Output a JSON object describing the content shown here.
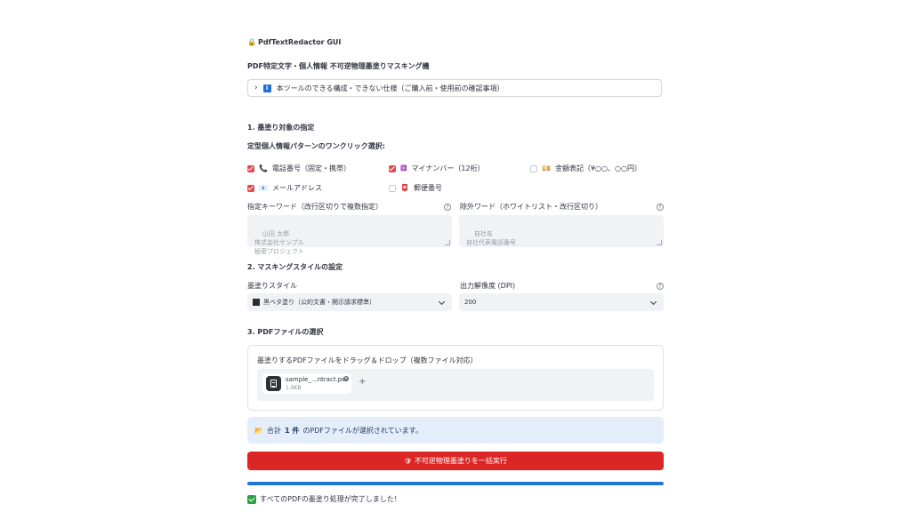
{
  "app": {
    "title": "PdfTextRedactor GUI",
    "subtitle": "PDF特定文字・個人情報 不可逆物理墨塗りマスキング機"
  },
  "expander": {
    "label": "本ツールのできる構成・できない仕様（ご購入前・使用前の確認事項）",
    "icon": "info-icon"
  },
  "section1": {
    "heading": "1. 墨塗り対象の指定",
    "patterns_label": "定型個人情報パターンのワンクリック選択:",
    "patterns": [
      {
        "label": "電話番号（固定・携帯）",
        "checked": true,
        "icon": "📞"
      },
      {
        "label": "マイナンバー（12桁）",
        "checked": true,
        "icon": "🆔"
      },
      {
        "label": "金額表記（¥○○、○○円）",
        "checked": false,
        "icon": "💴"
      },
      {
        "label": "メールアドレス",
        "checked": true,
        "icon": "📧"
      },
      {
        "label": "郵便番号",
        "checked": false,
        "icon": "📮"
      }
    ],
    "keyword_label": "指定キーワード（改行区切りで複数指定）",
    "keyword_placeholder": "山田 太郎\n株式会社サンプル\n秘密プロジェクト",
    "exclude_label": "除外ワード（ホワイトリスト・改行区切り）",
    "exclude_placeholder": "自社名\n自社代表電話番号"
  },
  "section2": {
    "heading": "2. マスキングスタイルの設定",
    "style_label": "墨塗りスタイル",
    "style_value": "黒ベタ塗り（公的文書・開示請求標準）",
    "dpi_label": "出力解像度 (DPI)",
    "dpi_value": "200"
  },
  "section3": {
    "heading": "3. PDFファイルの選択",
    "drop_label": "墨塗りするPDFファイルをドラッグ＆ドロップ（複数ファイル対応）",
    "file": {
      "name": "sample_...ntract.pdf",
      "size": "1.9KB"
    },
    "plus": "+"
  },
  "status": {
    "selected_prefix": "合計",
    "selected_count": "1 件",
    "selected_suffix": "のPDFファイルが選択されています。",
    "run_button": "不可逆物理墨塗りを一括実行",
    "progress": 1.0,
    "done_message": "すべてのPDFの墨塗り処理が完了しました！"
  },
  "colors": {
    "accent": "#dc2626",
    "checkbox": "#e5484d",
    "progress": "#1f77d4",
    "info_bg": "#e4eefb"
  }
}
